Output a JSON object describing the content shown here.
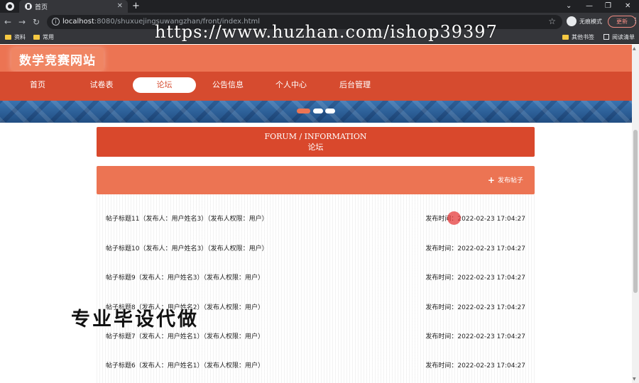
{
  "browser": {
    "tab_title": "首页",
    "url_host": "localhost",
    "url_path": ":8080/shuxuejingsuwangzhan/front/index.html",
    "incognito_label": "无痕模式",
    "update_label": "更新",
    "bookmarks_left": [
      "资料",
      "常用"
    ],
    "bookmarks_right": [
      "其他书签",
      "阅读清单"
    ],
    "watermark": "https://www.huzhan.com/ishop39397"
  },
  "site": {
    "title": "数学竞赛网站",
    "accent_color": "#ec7453",
    "nav_color": "#d64b2f",
    "nav": [
      {
        "label": "首页",
        "active": false
      },
      {
        "label": "试卷表",
        "active": false
      },
      {
        "label": "论坛",
        "active": true
      },
      {
        "label": "公告信息",
        "active": false
      },
      {
        "label": "个人中心",
        "active": false
      },
      {
        "label": "后台管理",
        "active": false
      }
    ]
  },
  "forum": {
    "heading_en": "FORUM / INFORMATION",
    "heading_cn": "论坛",
    "publish_label": "发布帖子",
    "posts": [
      {
        "title": "帖子标题11（发布人：用户姓名3）（发布人权限：用户）",
        "time": "发布时间：2022-02-23 17:04:27"
      },
      {
        "title": "帖子标题10（发布人：用户姓名3）（发布人权限：用户）",
        "time": "发布时间：2022-02-23 17:04:27"
      },
      {
        "title": "帖子标题9（发布人：用户姓名3）（发布人权限：用户）",
        "time": "发布时间：2022-02-23 17:04:27"
      },
      {
        "title": "帖子标题8（发布人：用户姓名2）（发布人权限：用户）",
        "time": "发布时间：2022-02-23 17:04:27"
      },
      {
        "title": "帖子标题7（发布人：用户姓名1）（发布人权限：用户）",
        "time": "发布时间：2022-02-23 17:04:27"
      },
      {
        "title": "帖子标题6（发布人：用户姓名1）（发布人权限：用户）",
        "time": "发布时间：2022-02-23 17:04:27"
      }
    ]
  },
  "overlay_text": "专业毕设代做"
}
